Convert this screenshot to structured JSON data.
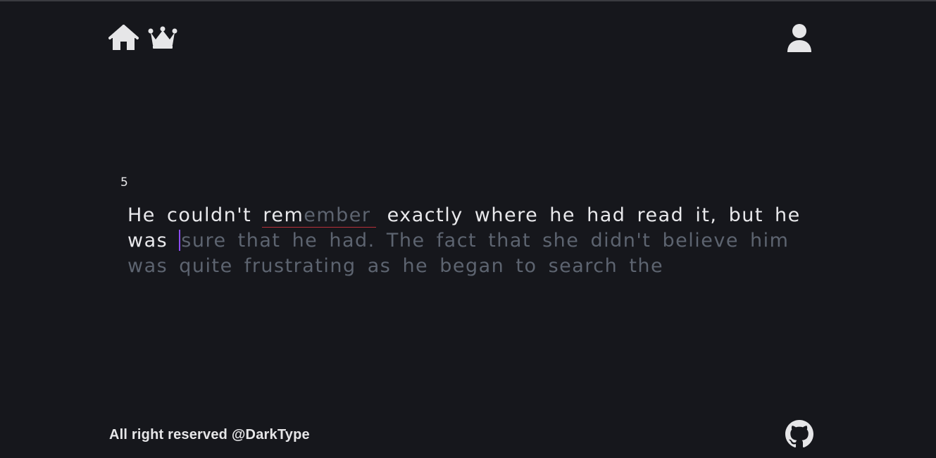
{
  "nav": {
    "home_icon": "home-icon",
    "leaderboard_icon": "crown-icon",
    "profile_icon": "user-icon"
  },
  "test": {
    "word_count": "5",
    "line1_typed_a": "He couldn't ",
    "line1_err_typed": "rem",
    "line1_err_pending": "ember",
    "line1_typed_b": "exactly where he had read it, but he",
    "line2_typed": "was ",
    "line2_pending": "sure that he had. The fact that she didn't believe him",
    "line3_pending": "was quite frustrating as he began to search the"
  },
  "footer": {
    "copyright": "All right reserved @DarkType",
    "github_icon": "github-icon"
  },
  "colors": {
    "background": "#16171c",
    "typed_text": "#e9e9ec",
    "pending_text": "#5d6470",
    "caret": "#8b4cf0",
    "error_underline": "#b8303a"
  }
}
